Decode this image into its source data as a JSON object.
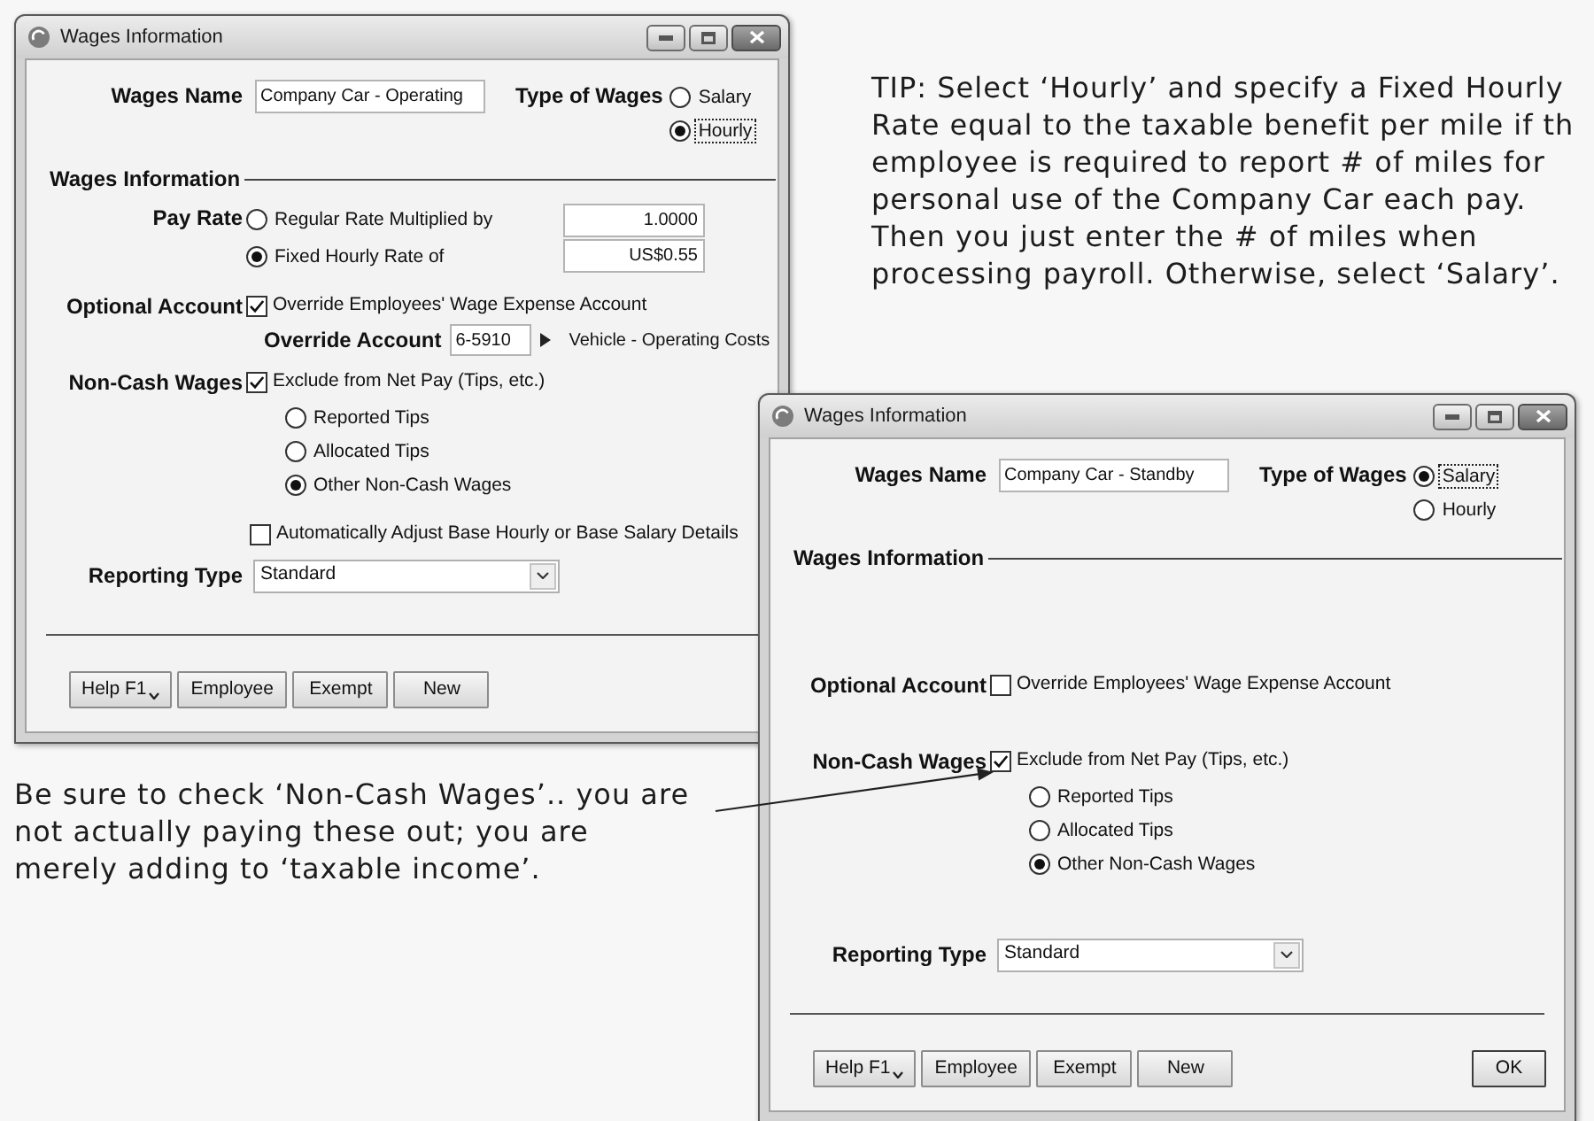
{
  "windows": [
    {
      "title": "Wages Information",
      "wages_name": {
        "label": "Wages Name",
        "value": "Company Car - Operating"
      },
      "type_of_wages": {
        "label": "Type of Wages",
        "options": [
          {
            "label": "Salary",
            "selected": false
          },
          {
            "label": "Hourly",
            "selected": true
          }
        ]
      },
      "section_title": "Wages Information",
      "pay_rate": {
        "label": "Pay Rate",
        "options": [
          {
            "label": "Regular Rate Multiplied by",
            "selected": false,
            "value": "1.0000"
          },
          {
            "label": "Fixed Hourly Rate of",
            "selected": true,
            "value": "US$0.55"
          }
        ]
      },
      "optional_account": {
        "label": "Optional Account",
        "checkbox": {
          "label": "Override Employees' Wage Expense Account",
          "checked": true
        },
        "override_account": {
          "label": "Override Account",
          "value": "6-5910",
          "account_name": "Vehicle - Operating Costs"
        }
      },
      "non_cash_wages": {
        "label": "Non-Cash Wages",
        "checkbox": {
          "label": "Exclude from Net Pay (Tips, etc.)",
          "checked": true
        },
        "options": [
          {
            "label": "Reported Tips",
            "selected": false
          },
          {
            "label": "Allocated Tips",
            "selected": false
          },
          {
            "label": "Other Non-Cash Wages",
            "selected": true
          }
        ]
      },
      "auto_adjust": {
        "label": "Automatically Adjust Base Hourly or Base Salary Details",
        "checked": false
      },
      "reporting_type": {
        "label": "Reporting Type",
        "value": "Standard"
      },
      "buttons": [
        {
          "label": "Help F1",
          "kind": "menu"
        },
        {
          "label": "Employee",
          "kind": "plain"
        },
        {
          "label": "Exempt",
          "kind": "plain"
        },
        {
          "label": "New",
          "kind": "plain"
        }
      ]
    },
    {
      "title": "Wages Information",
      "wages_name": {
        "label": "Wages Name",
        "value": "Company Car - Standby"
      },
      "type_of_wages": {
        "label": "Type of Wages",
        "options": [
          {
            "label": "Salary",
            "selected": true
          },
          {
            "label": "Hourly",
            "selected": false
          }
        ]
      },
      "section_title": "Wages Information",
      "optional_account": {
        "label": "Optional Account",
        "checkbox": {
          "label": "Override Employees' Wage Expense Account",
          "checked": false
        }
      },
      "non_cash_wages": {
        "label": "Non-Cash Wages",
        "checkbox": {
          "label": "Exclude from Net Pay (Tips, etc.)",
          "checked": true
        },
        "options": [
          {
            "label": "Reported Tips",
            "selected": false
          },
          {
            "label": "Allocated Tips",
            "selected": false
          },
          {
            "label": "Other Non-Cash Wages",
            "selected": true
          }
        ]
      },
      "reporting_type": {
        "label": "Reporting Type",
        "value": "Standard"
      },
      "buttons": [
        {
          "label": "Help F1",
          "kind": "menu"
        },
        {
          "label": "Employee",
          "kind": "plain"
        },
        {
          "label": "Exempt",
          "kind": "plain"
        },
        {
          "label": "New",
          "kind": "plain"
        },
        {
          "label": "OK",
          "kind": "default"
        }
      ]
    }
  ],
  "tip_lines": [
    "TIP: Select ‘Hourly’ and specify a Fixed Hourly",
    "Rate equal to the taxable benefit per mile if th",
    "employee is required to report # of miles for",
    "personal use of the Company Car each pay.",
    "Then you just enter the # of miles when",
    "processing payroll. Otherwise, select ‘Salary’."
  ],
  "note_lines": [
    "Be sure to check ‘Non-Cash Wages’.. you are",
    "not actually paying these out; you are",
    "merely adding to ‘taxable income’."
  ]
}
